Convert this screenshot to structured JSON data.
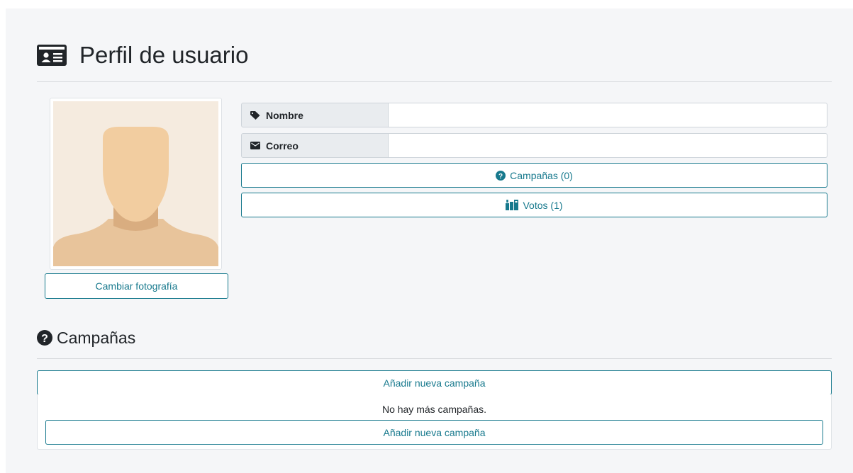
{
  "header": {
    "title": "Perfil de usuario",
    "icon": "id-card-icon"
  },
  "profile": {
    "photo_icon": "avatar-placeholder",
    "change_photo_label": "Cambiar fotografía",
    "fields": {
      "name": {
        "label": "Nombre",
        "icon": "tag-icon",
        "value": ""
      },
      "email": {
        "label": "Correo",
        "icon": "envelope-icon",
        "value": ""
      }
    },
    "campaigns_button": {
      "label": "Campañas (0)",
      "icon": "question-circle-icon"
    },
    "votes_button": {
      "label": "Votos (1)",
      "icon": "vote-box-icon"
    }
  },
  "campaigns_section": {
    "title": "Campañas",
    "icon": "question-circle-icon",
    "add_top_label": "Añadir nueva campaña",
    "empty_message": "No hay más campañas.",
    "add_bottom_label": "Añadir nueva campaña"
  },
  "colors": {
    "accent": "#17798d",
    "background": "#f5f6f8",
    "label_bg": "#e9ecef",
    "avatar_skin": "#f2cda0",
    "avatar_bg": "#f5ebdf"
  }
}
